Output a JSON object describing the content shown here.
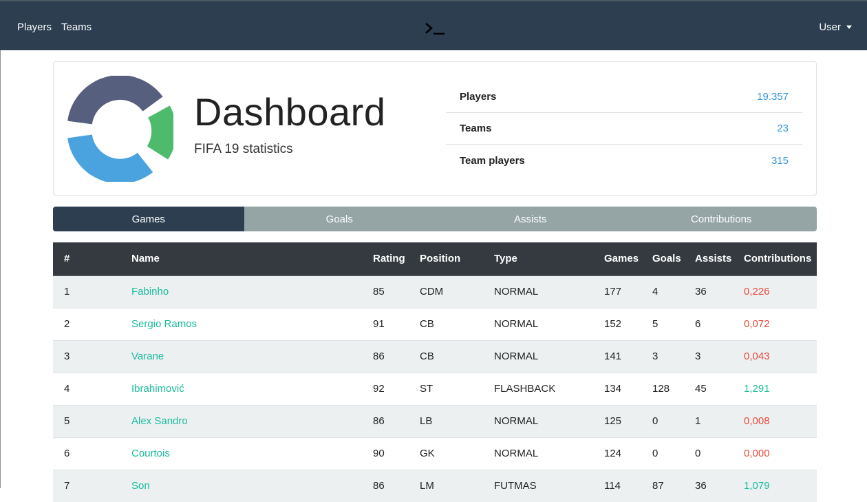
{
  "nav": {
    "players": "Players",
    "teams": "Teams",
    "user": "User"
  },
  "hero": {
    "title": "Dashboard",
    "subtitle": "FIFA 19 statistics",
    "stats": [
      {
        "label": "Players",
        "value": "19.357"
      },
      {
        "label": "Teams",
        "value": "23"
      },
      {
        "label": "Team players",
        "value": "315"
      }
    ]
  },
  "tabs": [
    "Games",
    "Goals",
    "Assists",
    "Contributions"
  ],
  "table": {
    "headers": [
      "#",
      "Name",
      "Rating",
      "Position",
      "Type",
      "Games",
      "Goals",
      "Assists",
      "Contributions"
    ],
    "rows": [
      {
        "num": "1",
        "name": "Fabinho",
        "rating": "85",
        "position": "CDM",
        "type": "NORMAL",
        "games": "177",
        "goals": "4",
        "assists": "36",
        "contributions": "0,226",
        "trend": "neg"
      },
      {
        "num": "2",
        "name": "Sergio Ramos",
        "rating": "91",
        "position": "CB",
        "type": "NORMAL",
        "games": "152",
        "goals": "5",
        "assists": "6",
        "contributions": "0,072",
        "trend": "neg"
      },
      {
        "num": "3",
        "name": "Varane",
        "rating": "86",
        "position": "CB",
        "type": "NORMAL",
        "games": "141",
        "goals": "3",
        "assists": "3",
        "contributions": "0,043",
        "trend": "neg"
      },
      {
        "num": "4",
        "name": "Ibrahimović",
        "rating": "92",
        "position": "ST",
        "type": "FLASHBACK",
        "games": "134",
        "goals": "128",
        "assists": "45",
        "contributions": "1,291",
        "trend": "pos"
      },
      {
        "num": "5",
        "name": "Alex Sandro",
        "rating": "86",
        "position": "LB",
        "type": "NORMAL",
        "games": "125",
        "goals": "0",
        "assists": "1",
        "contributions": "0,008",
        "trend": "neg"
      },
      {
        "num": "6",
        "name": "Courtois",
        "rating": "90",
        "position": "GK",
        "type": "NORMAL",
        "games": "124",
        "goals": "0",
        "assists": "0",
        "contributions": "0,000",
        "trend": "neg"
      },
      {
        "num": "7",
        "name": "Son",
        "rating": "86",
        "position": "LM",
        "type": "FUTMAS",
        "games": "114",
        "goals": "87",
        "assists": "36",
        "contributions": "1,079",
        "trend": "pos"
      }
    ]
  },
  "colors": {
    "navbar": "#2c3e50",
    "tab_active": "#2c3e50",
    "tab_inactive": "#95a5a6",
    "link": "#18bc9c",
    "stat_value": "#3498db",
    "negative": "#e74c3c",
    "logo_dark": "#56607e",
    "logo_green": "#4dbb6b",
    "logo_blue": "#4aa3df"
  }
}
